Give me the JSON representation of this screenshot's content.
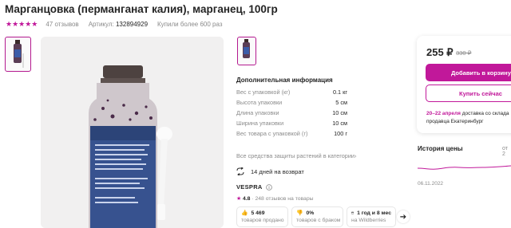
{
  "product": {
    "title": "Марганцовка (перманганат калия), марганец, 100гр",
    "stars": "★★★★★",
    "reviews": "47 отзывов",
    "article_label": "Артикул:",
    "article_value": "132894929",
    "bought": "Купили более 600 раз"
  },
  "details": {
    "title": "Дополнительная информация",
    "specs": [
      {
        "key": "Вес с упаковкой (кг)",
        "value": "0.1 кг"
      },
      {
        "key": "Высота упаковки",
        "value": "5 см"
      },
      {
        "key": "Длина упаковки",
        "value": "10 см"
      },
      {
        "key": "Ширина упаковки",
        "value": "10 см"
      },
      {
        "key": "Вес товара с упаковкой (г)",
        "value": "100 г"
      }
    ],
    "category_link": "Все средства защиты растений в категории",
    "return_text": "14 дней на возврат"
  },
  "brand": {
    "name": "VESPRA",
    "rating": "4.8",
    "rating_text": "· 248 отзывов на товары"
  },
  "stats": [
    {
      "value": "5 469",
      "label": "товаров продано",
      "icon": "thumbs-up-icon"
    },
    {
      "value": "0%",
      "label": "товаров с браком",
      "icon": "thumbs-down-icon"
    },
    {
      "value": "1 год и 8 мес",
      "label": "на Wildberries",
      "icon": "calendar-icon"
    }
  ],
  "buy": {
    "price": "255 ₽",
    "old_price": "330 ₽",
    "cart_label": "Добавить в корзину",
    "buy_now_label": "Купить сейчас",
    "delivery_date": "20–22 апреля",
    "delivery_rest": "доставка со склада",
    "delivery_line2": "продавца Екатеринбург"
  },
  "history": {
    "title": "История цены",
    "extra": "от 2",
    "date": "06.11.2022"
  },
  "colors": {
    "accent": "#c1189a",
    "muted": "#8b8b8b",
    "text": "#242424"
  }
}
